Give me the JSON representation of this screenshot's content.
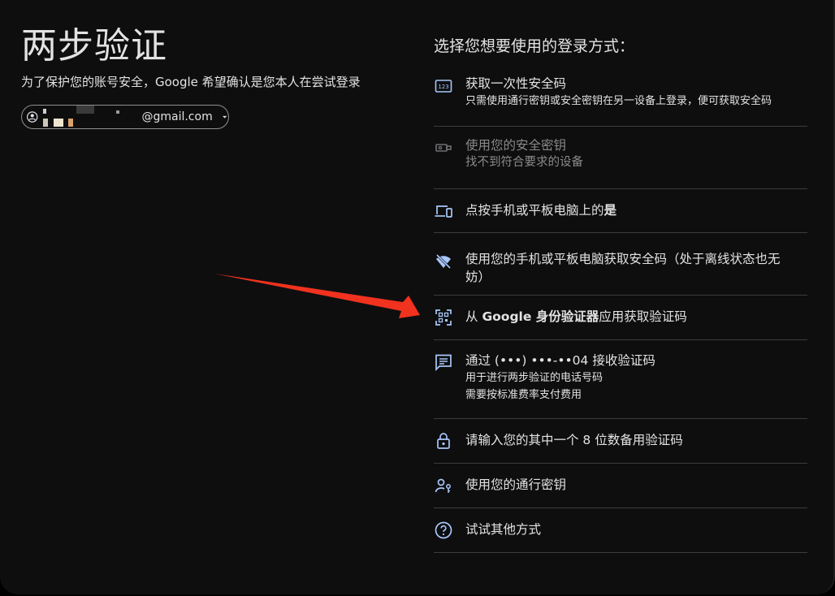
{
  "page": {
    "title": "两步验证",
    "subtitle": "为了保护您的账号安全，Google 希望确认是您本人在尝试登录",
    "account_chip": {
      "email_suffix": "@gmail.com"
    }
  },
  "options_heading": "选择您想要使用的登录方式：",
  "options": [
    {
      "icon": "numeric-code-icon",
      "line1": "获取一次性安全码",
      "line2": "只需使用通行密钥或安全密钥在另一设备上登录，便可获取安全码"
    },
    {
      "icon": "security-key-icon",
      "line1": "使用您的安全密钥",
      "line2": "找不到符合要求的设备",
      "disabled": true
    },
    {
      "icon": "devices-icon",
      "line1": "点按手机或平板电脑上的",
      "line1_bold": "是"
    },
    {
      "icon": "wifi-off-icon",
      "line1": "使用您的手机或平板电脑获取安全码（处于离线状态也无",
      "line1b": "妨）"
    },
    {
      "icon": "qr-scan-icon",
      "line1_pre": "从 ",
      "line1_bold": "Google 身份验证器",
      "line1_post": "应用获取验证码"
    },
    {
      "icon": "sms-icon",
      "line1": "通过 (•••) •••-••04 接收验证码",
      "line2": "用于进行两步验证的电话号码",
      "line3": "需要按标准费率支付费用"
    },
    {
      "icon": "lock-icon",
      "line1": "请输入您的其中一个 8 位数备用验证码"
    },
    {
      "icon": "passkey-icon",
      "line1": "使用您的通行密钥"
    },
    {
      "icon": "help-icon",
      "line1": "试试其他方式"
    }
  ],
  "colors": {
    "background": "#0e0e0f",
    "text": "#e3e3e3",
    "divider": "#3c3c3e",
    "arrow": "#f0321e"
  }
}
